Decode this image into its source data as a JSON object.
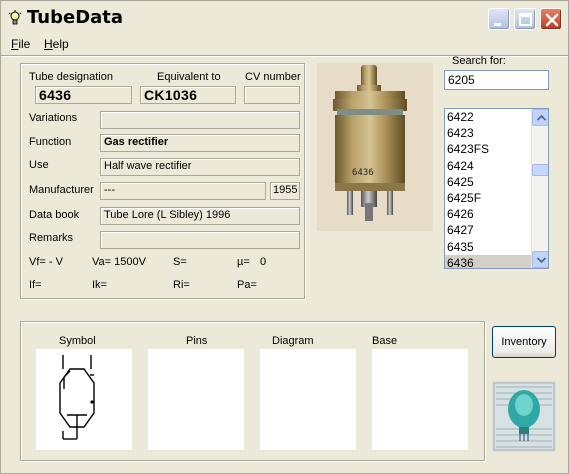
{
  "app": {
    "title": "TubeData"
  },
  "menu": {
    "file": "File",
    "file_acc": "F",
    "file_rest": "ile",
    "help": "Help",
    "help_acc": "H",
    "help_rest": "elp"
  },
  "labels": {
    "tube_designation": "Tube designation",
    "equivalent_to": "Equivalent to",
    "cv_number": "CV number",
    "variations": "Variations",
    "function": "Function",
    "use": "Use",
    "manufacturer": "Manufacturer",
    "data_book": "Data book",
    "remarks": "Remarks"
  },
  "fields": {
    "tube_designation": "6436",
    "equivalent_to": "CK1036",
    "cv_number": "",
    "variations": "",
    "function": "Gas rectifier",
    "use": "Half wave rectifier",
    "manufacturer": "---",
    "year": "1955",
    "data_book": "Tube Lore (L Sibley) 1996",
    "remarks": ""
  },
  "params": {
    "vf": "Vf= - V",
    "va": "Va= 1500V",
    "s": "S=",
    "mu": "µ=",
    "mu_val": "0",
    "if": "If=",
    "ik": "Ik=",
    "ri": "Ri=",
    "pa": "Pa="
  },
  "search": {
    "label": "Search for:",
    "value": "6205"
  },
  "tube_list": {
    "items": [
      "6422",
      "6423",
      "6423FS",
      "6424",
      "6425",
      "6425F",
      "6426",
      "6427",
      "6435",
      "6436"
    ],
    "selected": "6436"
  },
  "photo": {
    "marking": "6436"
  },
  "bottom": {
    "symbol": "Symbol",
    "pins": "Pins",
    "diagram": "Diagram",
    "base": "Base"
  },
  "buttons": {
    "inventory": "Inventory"
  },
  "colors": {
    "window_bg": "#ece9d8",
    "close_red": "#d54a2f",
    "list_selection": "#d4d0c8"
  }
}
